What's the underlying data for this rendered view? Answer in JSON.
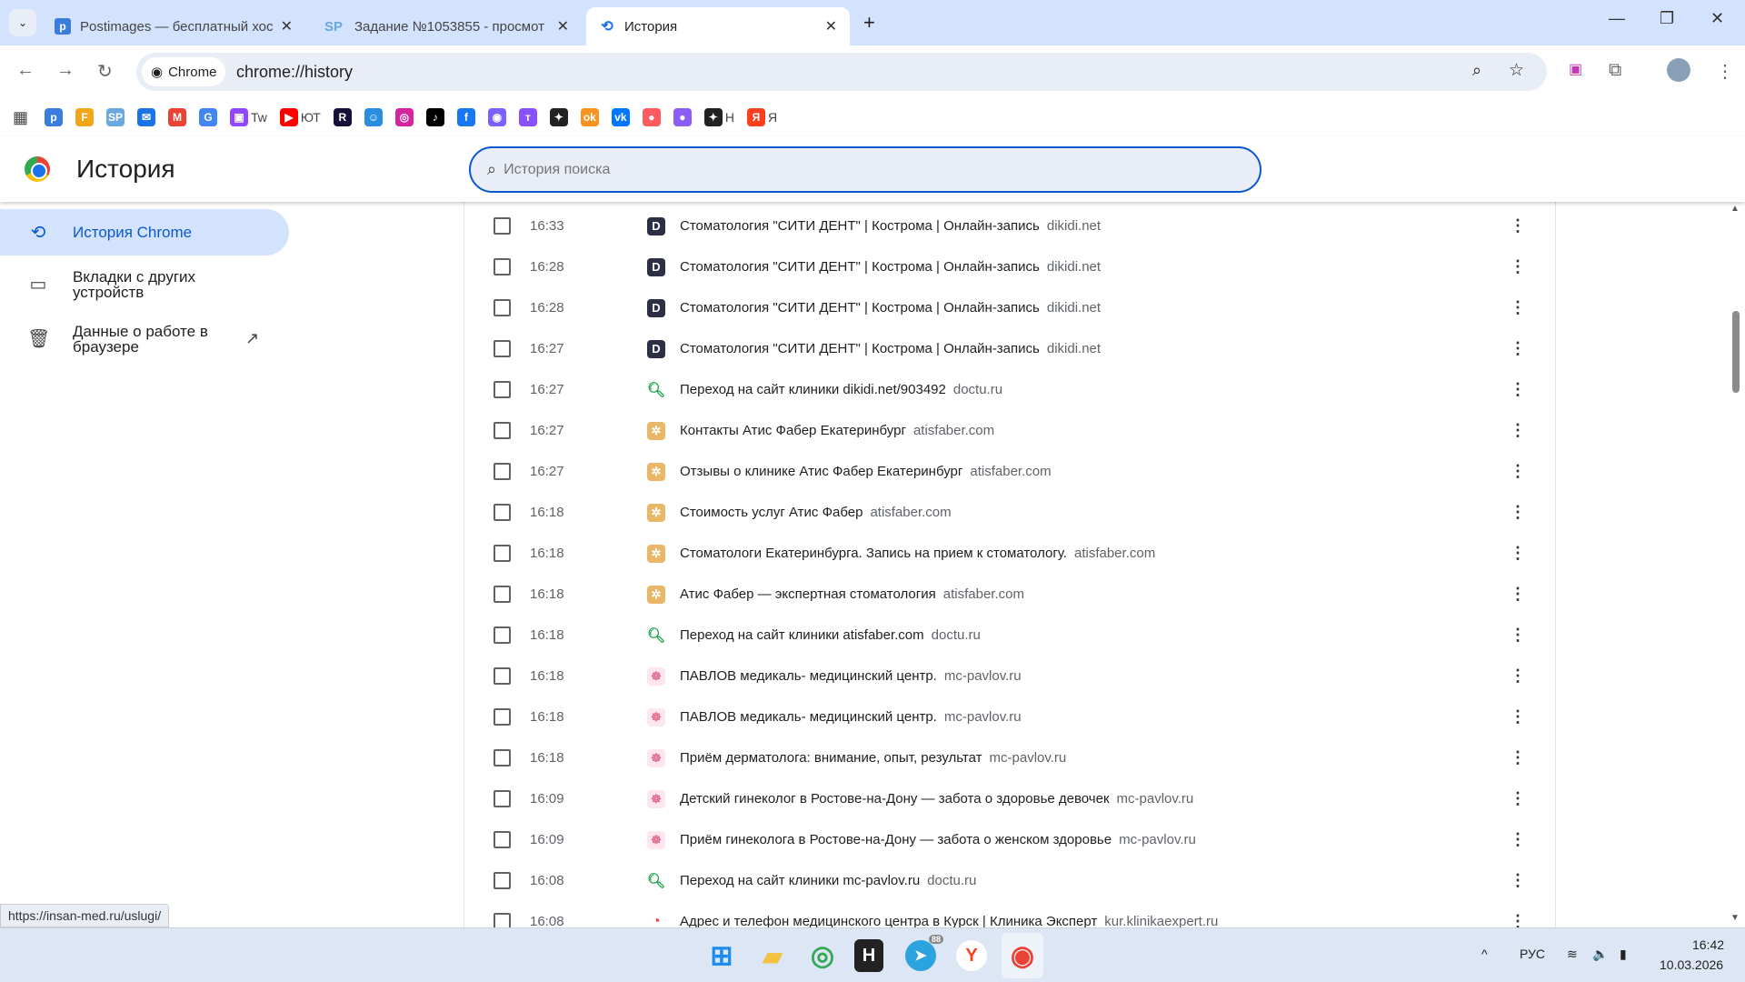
{
  "tabs": [
    {
      "title": "Postimages — бесплатный хос",
      "icon": "postimages-icon",
      "color": "#3b7ddd",
      "glyph": "p"
    },
    {
      "title": "Задание №1053855 - просмот",
      "icon": "sp-icon",
      "color": "#6aa8e0",
      "glyph": "SP"
    },
    {
      "title": "История",
      "icon": "history-icon",
      "active": true
    }
  ],
  "omnibox": {
    "chip": "Chrome",
    "url": "chrome://history"
  },
  "bookmarks": [
    {
      "icon": "postimages-icon",
      "glyph": "p",
      "color": "#3b7ddd",
      "label": ""
    },
    {
      "icon": "f-icon",
      "glyph": "F",
      "color": "#f2a71b",
      "label": ""
    },
    {
      "icon": "sp-icon",
      "glyph": "SP",
      "color": "#6aa8e0",
      "label": ""
    },
    {
      "icon": "mail-icon",
      "glyph": "✉",
      "color": "#1a73e8",
      "label": ""
    },
    {
      "icon": "gmail-icon",
      "glyph": "M",
      "color": "#ea4335",
      "label": ""
    },
    {
      "icon": "google-icon",
      "glyph": "G",
      "color": "#4285f4",
      "label": ""
    },
    {
      "icon": "twitch-icon",
      "glyph": "▣",
      "color": "#9146ff",
      "label": "Tw"
    },
    {
      "icon": "youtube-icon",
      "glyph": "▶",
      "color": "#ff0000",
      "label": "ЮТ"
    },
    {
      "icon": "rutube-icon",
      "glyph": "R",
      "color": "#14103a",
      "label": ""
    },
    {
      "icon": "smile-icon",
      "glyph": "☺",
      "color": "#2a8ee0",
      "label": ""
    },
    {
      "icon": "instagram-icon",
      "glyph": "◎",
      "color": "#d6249f",
      "label": ""
    },
    {
      "icon": "tiktok-icon",
      "glyph": "♪",
      "color": "#000000",
      "label": ""
    },
    {
      "icon": "facebook-icon",
      "glyph": "f",
      "color": "#1877f2",
      "label": ""
    },
    {
      "icon": "messenger-icon",
      "glyph": "◉",
      "color": "#7b61ff",
      "label": ""
    },
    {
      "icon": "t-icon",
      "glyph": "т",
      "color": "#8a4fff",
      "label": ""
    },
    {
      "icon": "sparkle-icon",
      "glyph": "✦",
      "color": "#222222",
      "label": ""
    },
    {
      "icon": "ok-icon",
      "glyph": "ok",
      "color": "#f7931e",
      "label": ""
    },
    {
      "icon": "vk-icon",
      "glyph": "vk",
      "color": "#0077ff",
      "label": ""
    },
    {
      "icon": "record-icon",
      "glyph": "●",
      "color": "#ff5a5f",
      "label": ""
    },
    {
      "icon": "drop-icon",
      "glyph": "●",
      "color": "#8b5cf6",
      "label": ""
    },
    {
      "icon": "sparkle-icon",
      "glyph": "✦",
      "color": "#222222",
      "label": "Н"
    },
    {
      "icon": "yandex-icon",
      "glyph": "Я",
      "color": "#fc3f1d",
      "label": "Я"
    }
  ],
  "page": {
    "title": "История",
    "search_placeholder": "История поиска"
  },
  "sidebar": [
    {
      "label": "История Chrome",
      "icon": "history-icon",
      "active": true
    },
    {
      "label": "Вкладки с других устройств",
      "icon": "devices-icon"
    },
    {
      "label": "Данные о работе в браузере",
      "icon": "trash-icon",
      "external": true
    }
  ],
  "history": [
    {
      "time": "16:33",
      "title": "Стоматология \"СИТИ ДЕНТ\" | Кострома | Онлайн-запись",
      "domain": "dikidi.net",
      "fav": "D"
    },
    {
      "time": "16:28",
      "title": "Стоматология \"СИТИ ДЕНТ\" | Кострома | Онлайн-запись",
      "domain": "dikidi.net",
      "fav": "D"
    },
    {
      "time": "16:28",
      "title": "Стоматология \"СИТИ ДЕНТ\" | Кострома | Онлайн-запись",
      "domain": "dikidi.net",
      "fav": "D"
    },
    {
      "time": "16:27",
      "title": "Стоматология \"СИТИ ДЕНТ\" | Кострома | Онлайн-запись",
      "domain": "dikidi.net",
      "fav": "D"
    },
    {
      "time": "16:27",
      "title": "Переход на сайт клиники dikidi.net/903492",
      "domain": "doctu.ru",
      "fav": "Q"
    },
    {
      "time": "16:27",
      "title": "Контакты Атис Фабер Екатеринбург",
      "domain": "atisfaber.com",
      "fav": "A"
    },
    {
      "time": "16:27",
      "title": "Отзывы о клинике Атис Фабер Екатеринбург",
      "domain": "atisfaber.com",
      "fav": "A"
    },
    {
      "time": "16:18",
      "title": "Стоимость услуг Атис Фабер",
      "domain": "atisfaber.com",
      "fav": "A"
    },
    {
      "time": "16:18",
      "title": "Стоматологи Екатеринбурга. Запись на прием к стоматологу.",
      "domain": "atisfaber.com",
      "fav": "A"
    },
    {
      "time": "16:18",
      "title": "Атис Фабер — экспертная стоматология",
      "domain": "atisfaber.com",
      "fav": "A"
    },
    {
      "time": "16:18",
      "title": "Переход на сайт клиники atisfaber.com",
      "domain": "doctu.ru",
      "fav": "Q"
    },
    {
      "time": "16:18",
      "title": "ПАВЛОВ медикаль- медицинский центр.",
      "domain": "mc-pavlov.ru",
      "fav": "P"
    },
    {
      "time": "16:18",
      "title": "ПАВЛОВ медикаль- медицинский центр.",
      "domain": "mc-pavlov.ru",
      "fav": "P"
    },
    {
      "time": "16:18",
      "title": "Приём дерматолога: внимание, опыт, результат",
      "domain": "mc-pavlov.ru",
      "fav": "P"
    },
    {
      "time": "16:09",
      "title": "Детский гинеколог в Ростове-на-Дону — забота о здоровье девочек",
      "domain": "mc-pavlov.ru",
      "fav": "P"
    },
    {
      "time": "16:09",
      "title": "Приём гинеколога в Ростове-на-Дону — забота о женском здоровье",
      "domain": "mc-pavlov.ru",
      "fav": "P"
    },
    {
      "time": "16:08",
      "title": "Переход на сайт клиники mc-pavlov.ru",
      "domain": "doctu.ru",
      "fav": "Q"
    },
    {
      "time": "16:08",
      "title": "Адрес и телефон медицинского центра в Курск | Клиника Эксперт",
      "domain": "kur.klinikaexpert.ru",
      "fav": "E"
    }
  ],
  "status_url": "https://insan-med.ru/uslugi/",
  "taskbar": {
    "telegram_badge": "88",
    "lang": "РУС",
    "time": "16:42",
    "date": "10.03.2026"
  }
}
